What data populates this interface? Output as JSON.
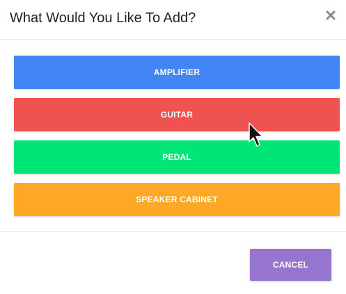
{
  "dialog": {
    "title": "What Would You Like To Add?",
    "close_icon": "close-icon"
  },
  "options": [
    {
      "label": "AMPLIFIER",
      "color": "#4285f4"
    },
    {
      "label": "GUITAR",
      "color": "#ef5350"
    },
    {
      "label": "PEDAL",
      "color": "#00e676"
    },
    {
      "label": "SPEAKER CABINET",
      "color": "#ffa726"
    }
  ],
  "footer": {
    "cancel_label": "CANCEL",
    "cancel_color": "#9575cd"
  },
  "cursor": {
    "icon": "mouse-pointer-icon"
  }
}
